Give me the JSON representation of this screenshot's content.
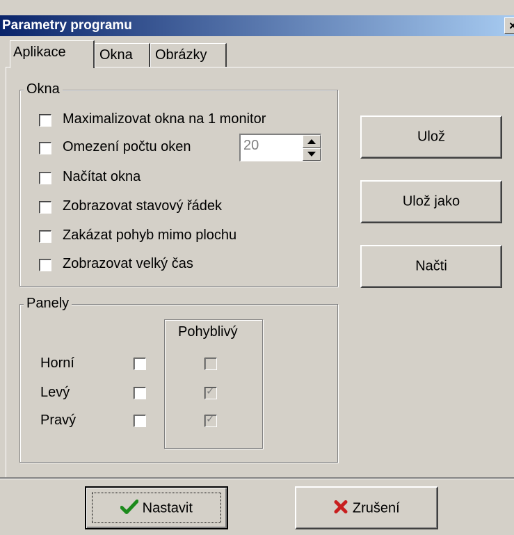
{
  "window": {
    "title": "Parametry programu",
    "close_glyph": "×"
  },
  "tabs": [
    {
      "label": "Aplikace",
      "active": true
    },
    {
      "label": "Okna",
      "active": false
    },
    {
      "label": "Obrázky",
      "active": false
    }
  ],
  "okna_group": {
    "legend": "Okna",
    "items": [
      {
        "label": "Maximalizovat okna na 1 monitor",
        "checked": false
      },
      {
        "label": "Omezení počtu oken",
        "checked": false
      },
      {
        "label": "Načítat okna",
        "checked": false
      },
      {
        "label": "Zobrazovat stavový řádek",
        "checked": false
      },
      {
        "label": "Zakázat pohyb mimo plochu",
        "checked": false
      },
      {
        "label": "Zobrazovat velký čas",
        "checked": false
      }
    ],
    "window_limit": {
      "value": "20"
    }
  },
  "panely_group": {
    "legend": "Panely",
    "movable_header": "Pohyblivý",
    "rows": [
      {
        "label": "Horní",
        "enabled": false,
        "movable": false
      },
      {
        "label": "Levý",
        "enabled": false,
        "movable": true
      },
      {
        "label": "Pravý",
        "enabled": false,
        "movable": true
      }
    ]
  },
  "side_buttons": {
    "save": "Ulož",
    "save_as": "Ulož jako",
    "load": "Načti"
  },
  "footer": {
    "ok_label": "Nastavit",
    "ok_icon": "green-checkmark-icon",
    "ok_icon_color": "#1c8a1c",
    "cancel_label": "Zrušení",
    "cancel_icon": "red-x-icon",
    "cancel_icon_color": "#c81e1e"
  }
}
